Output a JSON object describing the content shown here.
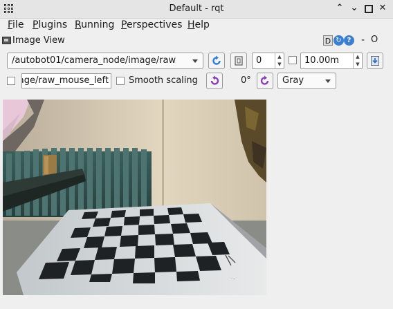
{
  "window": {
    "title": "Default - rqt"
  },
  "menubar": {
    "items": [
      {
        "mnemonic": "F",
        "rest": "ile"
      },
      {
        "mnemonic": "P",
        "rest": "lugins"
      },
      {
        "mnemonic": "R",
        "rest": "unning"
      },
      {
        "mnemonic": "P",
        "rest": "erspectives"
      },
      {
        "mnemonic": "H",
        "rest": "elp"
      }
    ]
  },
  "panel": {
    "title": "Image View",
    "d_label": "D",
    "minimize_label": "-",
    "float_label": "O"
  },
  "toolbar": {
    "topic": "/autobot01/camera_node/image/raw",
    "frame_count": "0",
    "max_value": "10.00m",
    "mouse_topic": "/image/raw_mouse_left",
    "smooth_scaling_label": "Smooth scaling",
    "rotation_label": "0°",
    "color_scheme": "Gray",
    "smooth_scaling_checked": false,
    "publish_mouse_checked": false,
    "dynamic_range_checked": false
  },
  "image": {
    "description_icon": "camera-image"
  }
}
